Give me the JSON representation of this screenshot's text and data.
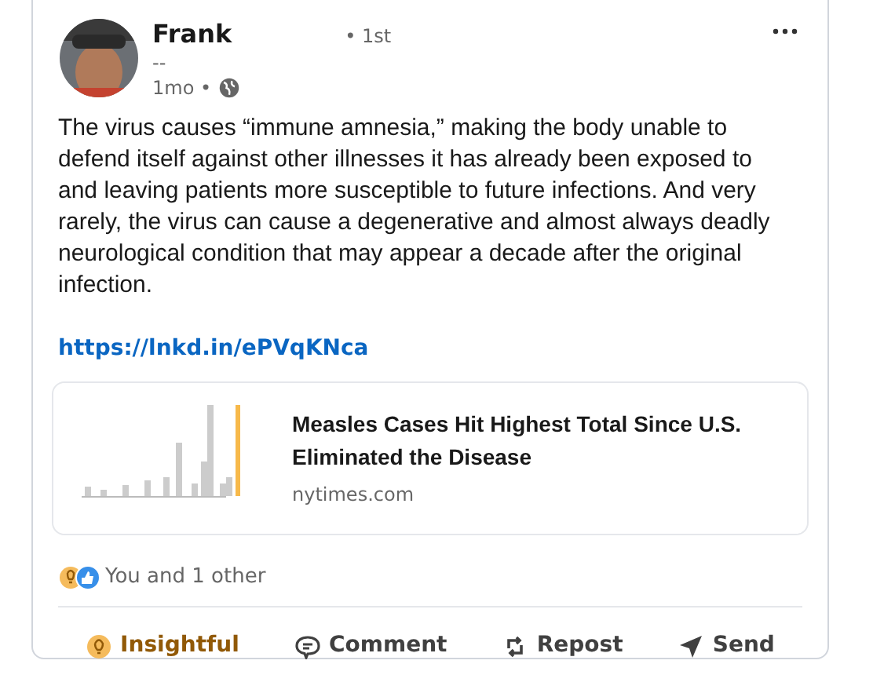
{
  "author": {
    "name": "Frank",
    "degree": "• 1st",
    "headline": "--",
    "time": "1mo •"
  },
  "post_text": "The virus causes “immune amnesia,” making the body unable to defend itself against other illnesses it has already been exposed to and leaving patients more susceptible to future infections. And very rarely, the virus can cause a degenerative and almost always deadly neurological condition that may appear a decade after the original infection.",
  "link": "https://lnkd.in/ePVqKNca",
  "preview": {
    "title": "Measles Cases Hit Highest Total Since U.S. Eliminated the Disease",
    "source": "nytimes.com"
  },
  "reactions": {
    "summary": "You and 1 other"
  },
  "actions": [
    {
      "kind": "insightful",
      "label": "Insightful",
      "selected": true
    },
    {
      "kind": "comment",
      "label": "Comment",
      "selected": false
    },
    {
      "kind": "repost",
      "label": "Repost",
      "selected": false
    },
    {
      "kind": "send",
      "label": "Send",
      "selected": false
    }
  ]
}
